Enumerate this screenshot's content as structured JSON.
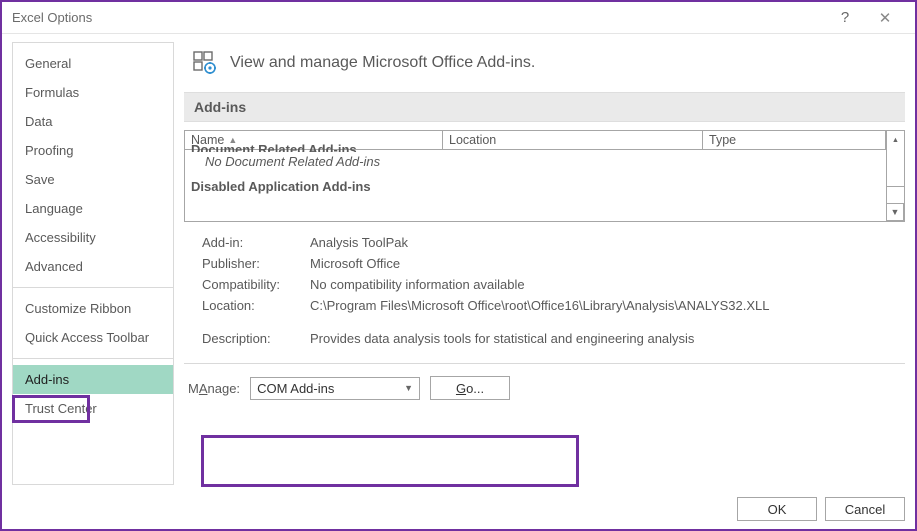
{
  "window": {
    "title": "Excel Options"
  },
  "sidebar": {
    "items": [
      "General",
      "Formulas",
      "Data",
      "Proofing",
      "Save",
      "Language",
      "Accessibility",
      "Advanced"
    ],
    "items2": [
      "Customize Ribbon",
      "Quick Access Toolbar"
    ],
    "items3": [
      "Add-ins",
      "Trust Center"
    ],
    "selected": "Add-ins"
  },
  "heading": "View and manage Microsoft Office Add-ins.",
  "section_header": "Add-ins",
  "columns": {
    "name": "Name",
    "location": "Location",
    "type": "Type"
  },
  "list": {
    "cutoff_group": "Document Related Add-ins",
    "cutoff_note": "No Document Related Add-ins",
    "group": "Disabled Application Add-ins"
  },
  "details": {
    "addin_k": "Add-in:",
    "addin_v": "Analysis ToolPak",
    "publisher_k": "Publisher:",
    "publisher_v": "Microsoft Office",
    "compat_k": "Compatibility:",
    "compat_v": "No compatibility information available",
    "location_k": "Location:",
    "location_v": "C:\\Program Files\\Microsoft Office\\root\\Office16\\Library\\Analysis\\ANALYS32.XLL",
    "desc_k": "Description:",
    "desc_v": "Provides data analysis tools for statistical and engineering analysis"
  },
  "manage": {
    "label_prefix": "Manage:",
    "underline_char": "A",
    "selected": "COM Add-ins",
    "go_underline": "G",
    "go_rest": "o..."
  },
  "buttons": {
    "ok": "OK",
    "cancel": "Cancel"
  }
}
